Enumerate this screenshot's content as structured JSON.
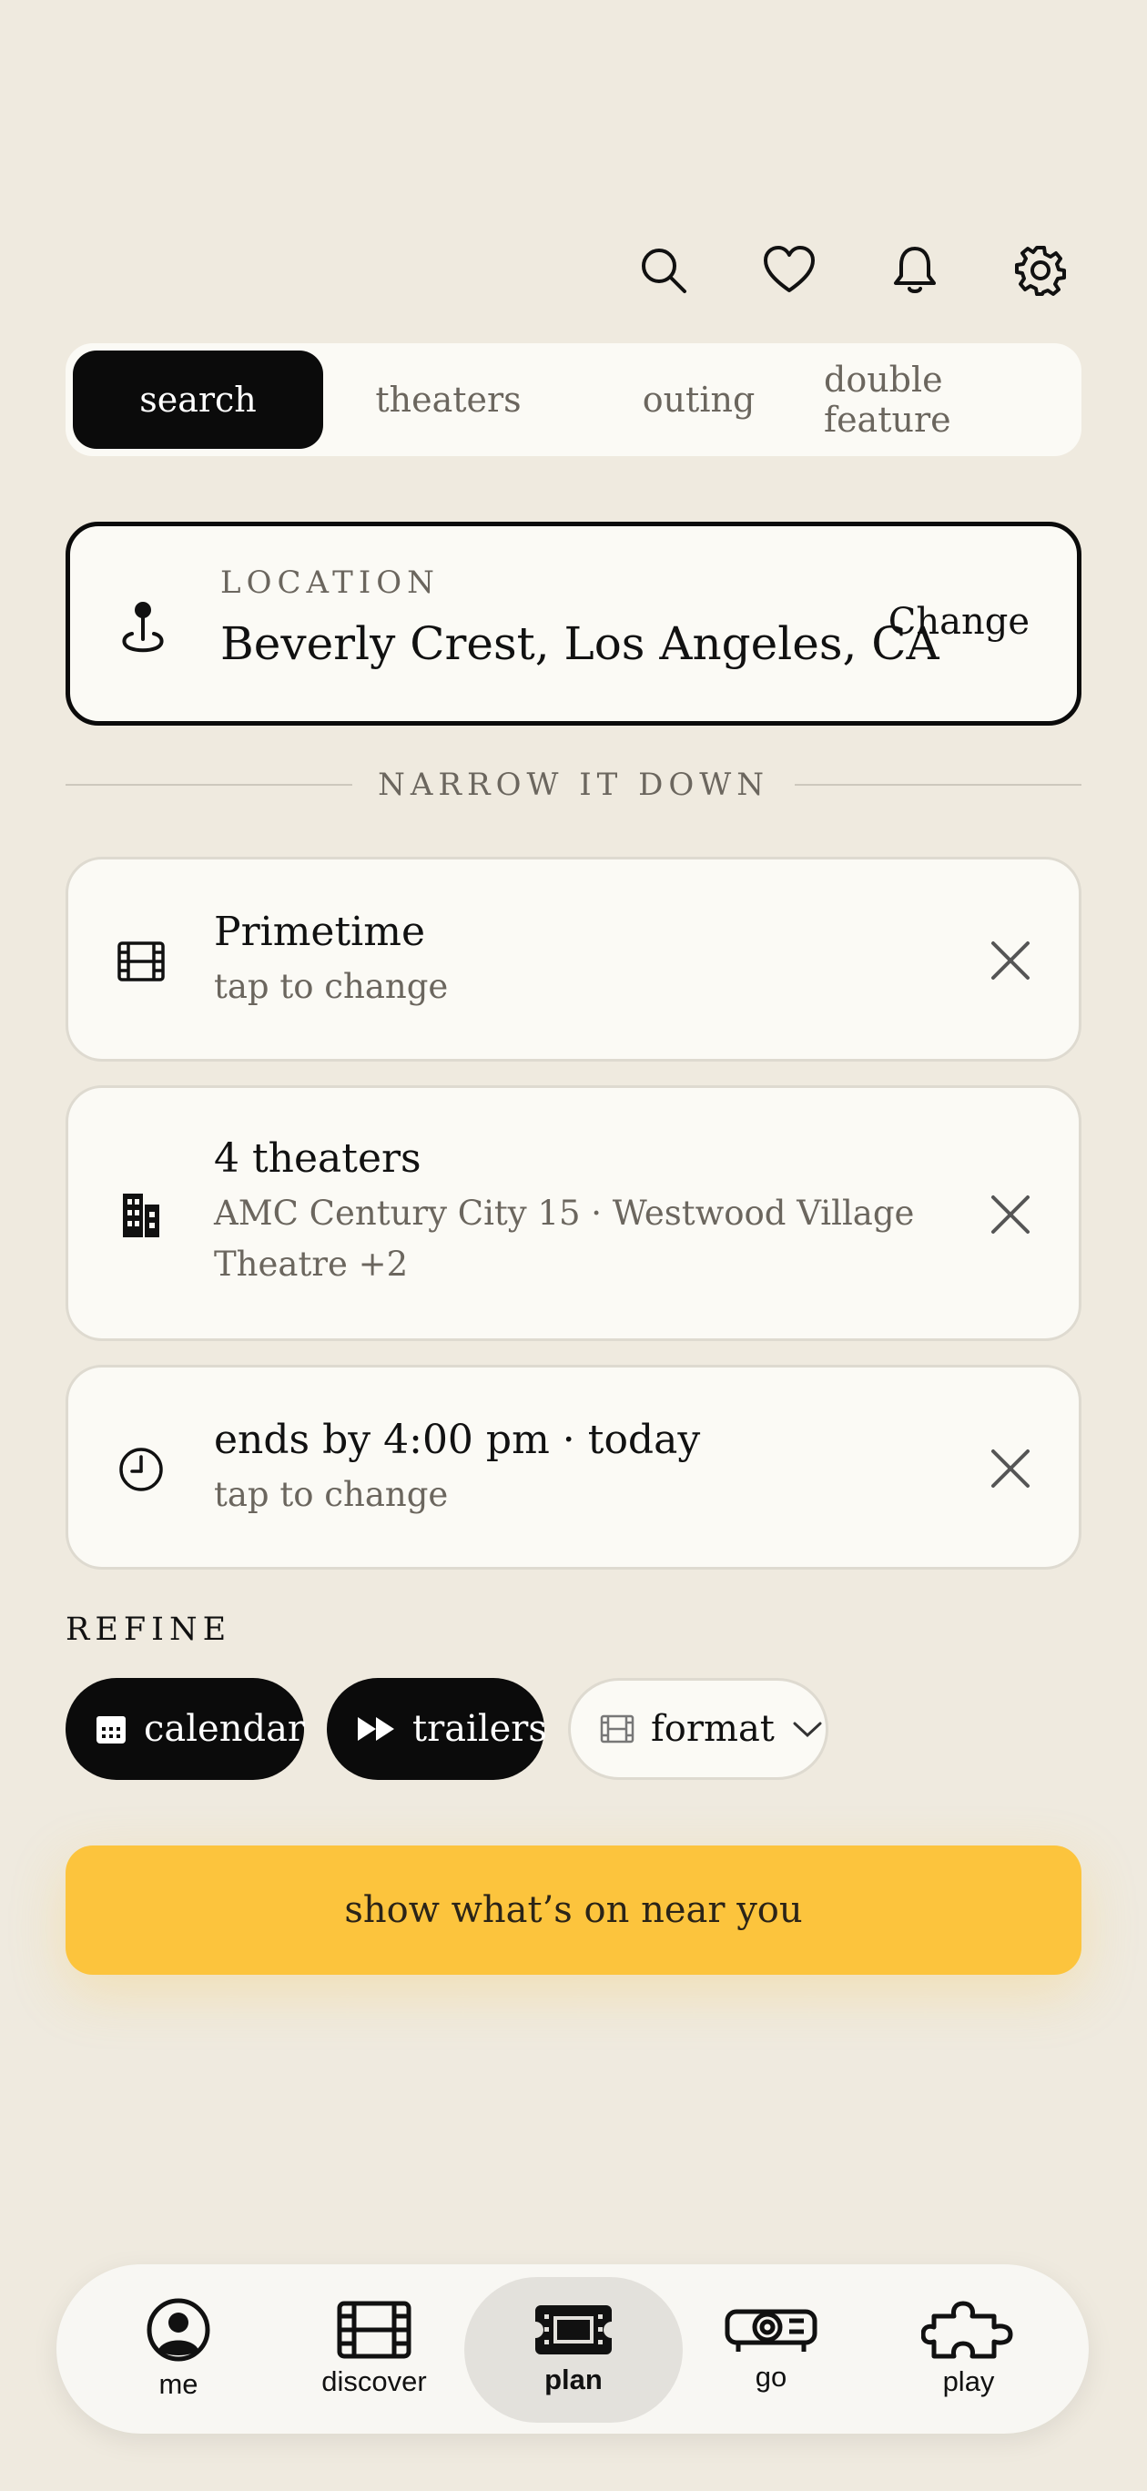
{
  "tabs": [
    {
      "label": "search",
      "active": true
    },
    {
      "label": "theaters",
      "active": false
    },
    {
      "label": "outing",
      "active": false
    },
    {
      "label": "double feature",
      "active": false
    }
  ],
  "location": {
    "label": "LOCATION",
    "value": "Beverly Crest, Los Angeles, CA",
    "change_label": "Change"
  },
  "narrow_label": "NARROW IT DOWN",
  "filters": [
    {
      "icon": "film-icon",
      "title": "Primetime",
      "subtitle": "tap to change"
    },
    {
      "icon": "building-icon",
      "title": "4 theaters",
      "subtitle": "AMC Century City 15 · Westwood Village Theatre +2"
    },
    {
      "icon": "clock-icon",
      "title": "ends by 4:00 pm · today",
      "subtitle": "tap to change"
    }
  ],
  "refine": {
    "label": "REFINE",
    "chips": [
      {
        "icon": "calendar-icon",
        "label": "calendar",
        "selected": true
      },
      {
        "icon": "fast-forward-icon",
        "label": "trailers",
        "selected": true
      },
      {
        "icon": "film-icon",
        "label": "format",
        "selected": false
      }
    ]
  },
  "cta_label": "show what’s on near you",
  "nav": [
    {
      "icon": "person-icon",
      "label": "me",
      "active": false
    },
    {
      "icon": "film-strip-icon",
      "label": "discover",
      "active": false
    },
    {
      "icon": "ticket-icon",
      "label": "plan",
      "active": true
    },
    {
      "icon": "projector-icon",
      "label": "go",
      "active": false
    },
    {
      "icon": "puzzle-icon",
      "label": "play",
      "active": false
    }
  ],
  "colors": {
    "background": "#efeadf",
    "card": "#fbfaf5",
    "accent": "#fcc43d",
    "dark": "#0b0b0b",
    "muted_text": "#6b665e"
  }
}
